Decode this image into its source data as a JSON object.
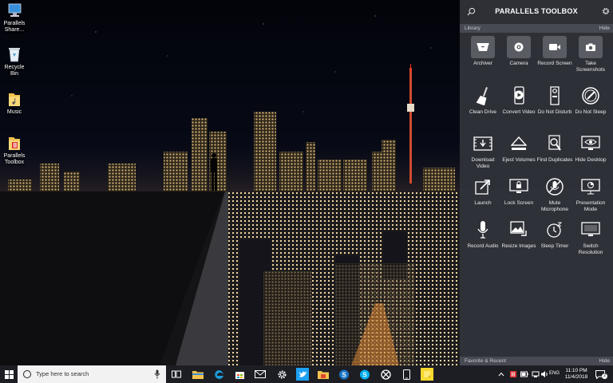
{
  "desktop": {
    "icons": [
      {
        "label": "Parallels Share...",
        "icon": "network-share-icon"
      },
      {
        "label": "Recycle Bin",
        "icon": "recycle-bin-icon"
      },
      {
        "label": "Music",
        "icon": "music-folder-icon"
      },
      {
        "label": "Parallels Toolbox",
        "icon": "parallels-toolbox-icon"
      }
    ]
  },
  "toolbox": {
    "title": "PARALLELS TOOLBOX",
    "library_label": "Library",
    "library_hide": "Hide",
    "favorites_label": "Favorite & Recent",
    "favorites_hide": "Hide",
    "tools": [
      {
        "label": "Archiver",
        "icon": "archive-box-icon"
      },
      {
        "label": "Camera",
        "icon": "camera-lens-icon"
      },
      {
        "label": "Record Screen",
        "icon": "video-camera-icon"
      },
      {
        "label": "Take Screenshots",
        "icon": "screenshot-camera-icon"
      },
      {
        "label": "Clean Drive",
        "icon": "broom-icon"
      },
      {
        "label": "Convert Video",
        "icon": "phone-play-icon"
      },
      {
        "label": "Do Not Disturb",
        "icon": "door-hanger-icon"
      },
      {
        "label": "Do Not Sleep",
        "icon": "sleep-gauge-icon"
      },
      {
        "label": "Download Video",
        "icon": "film-download-icon"
      },
      {
        "label": "Eject Volumes",
        "icon": "eject-icon"
      },
      {
        "label": "Find Duplicates",
        "icon": "find-duplicates-icon"
      },
      {
        "label": "Hide Desktop",
        "icon": "monitor-eye-icon"
      },
      {
        "label": "Launch",
        "icon": "launch-arrow-icon"
      },
      {
        "label": "Lock Screen",
        "icon": "lock-monitor-icon"
      },
      {
        "label": "Mute Microphone",
        "icon": "mute-mic-icon"
      },
      {
        "label": "Presentation Mode",
        "icon": "presentation-icon"
      },
      {
        "label": "Record Audio",
        "icon": "microphone-icon"
      },
      {
        "label": "Resize Images",
        "icon": "resize-image-icon"
      },
      {
        "label": "Sleep Timer",
        "icon": "sleep-timer-icon"
      },
      {
        "label": "Switch Resolution",
        "icon": "monitor-resolution-icon"
      }
    ]
  },
  "taskbar": {
    "search_placeholder": "Type here to search",
    "language": "ENG",
    "time": "11:10 PM",
    "date": "11/4/2018",
    "pinned": [
      "task-view-icon",
      "file-explorer-icon",
      "edge-icon",
      "store-icon",
      "mail-icon",
      "settings-icon",
      "twitter-icon",
      "folder-icon",
      "skype-business-icon",
      "skype-icon",
      "xbox-icon",
      "phone-icon",
      "sticky-notes-icon"
    ],
    "notification_count": "2"
  },
  "colors": {
    "panel_bg": "#32343a",
    "taskbar_bg": "#1d1e24",
    "accent_blue": "#1a9bd7"
  }
}
